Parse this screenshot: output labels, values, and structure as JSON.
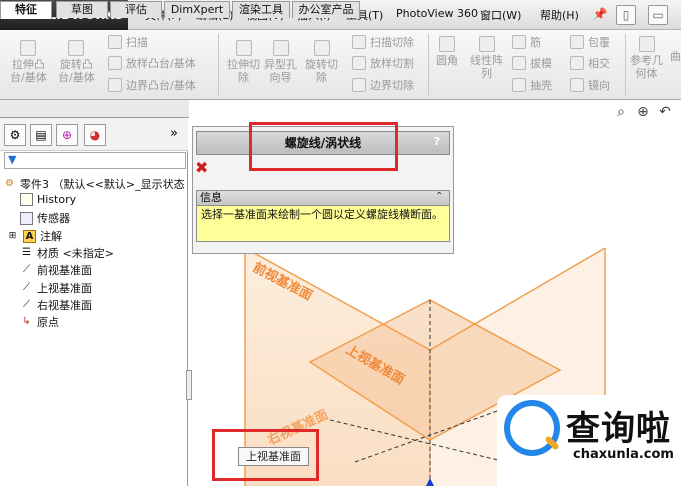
{
  "app": {
    "logo": "SOLIDWORKS",
    "logo_mark": "ƷS"
  },
  "menu": [
    "文件(F)",
    "编辑(E)",
    "视图(V)",
    "插入(I)",
    "工具(T)",
    "PhotoView 360",
    "窗口(W)",
    "帮助(H)"
  ],
  "ribbon": {
    "extrude_boss": "拉伸凸\n台/基体",
    "revolve_boss": "旋转凸\n台/基体",
    "sweep": "扫描",
    "loft": "放样凸台/基体",
    "boundary": "边界凸台/基体",
    "extrude_cut": "拉伸切\n除",
    "hole_wizard": "异型孔\n向导",
    "revolve_cut": "旋转切\n除",
    "swept_cut": "扫描切除",
    "lofted_cut": "放样切割",
    "boundary_cut": "边界切除",
    "fillet": "圆角",
    "linear_pattern": "线性阵\n列",
    "rib": "筋",
    "draft": "拔模",
    "shell": "抽壳",
    "wrap": "包覆",
    "intersect": "相交",
    "mirror": "镜向",
    "ref_geometry": "参考几\n何体",
    "curves": "曲"
  },
  "tabs": [
    "特征",
    "草图",
    "评估",
    "DimXpert",
    "渲染工具",
    "办公室产品"
  ],
  "tree": {
    "part": "零件3 （默认<<默认>_显示状态",
    "items": [
      "History",
      "传感器",
      "注解",
      "材质 <未指定>",
      "前视基准面",
      "上视基准面",
      "右视基准面",
      "原点"
    ]
  },
  "property_manager": {
    "title": "螺旋线/涡状线",
    "help": "?",
    "info_header": "信息",
    "info_text": "选择一基准面来绘制一个圆以定义螺旋线横断面。"
  },
  "planes": {
    "front": "前视基准面",
    "top": "上视基准面",
    "right": "右视基准面"
  },
  "tooltip": "上视基准面",
  "watermark": {
    "cn": "查询啦",
    "en": "chaxunla.com"
  },
  "colors": {
    "accent_red": "#e02a2a",
    "plane_orange": "#f0a050",
    "info_yellow": "#ffff99"
  }
}
